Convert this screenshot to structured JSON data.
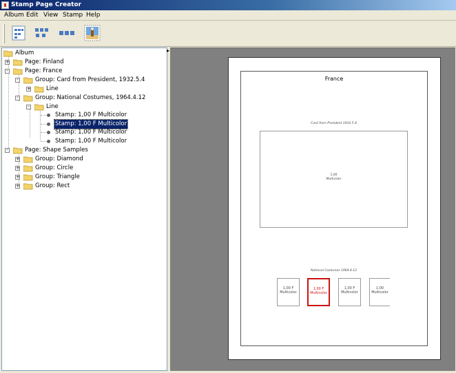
{
  "window": {
    "title": "Stamp Page Creator"
  },
  "menu": [
    {
      "id": "album",
      "label": "Album"
    },
    {
      "id": "edit",
      "label": "Edit"
    },
    {
      "id": "view",
      "label": "View"
    },
    {
      "id": "stamp",
      "label": "Stamp"
    },
    {
      "id": "help",
      "label": "Help"
    }
  ],
  "toolbar": {
    "buttons": [
      {
        "name": "new-page-icon"
      },
      {
        "name": "add-group-icon"
      },
      {
        "name": "add-line-icon"
      },
      {
        "name": "add-stamp-image-icon"
      }
    ]
  },
  "tree": {
    "rows": [
      {
        "label": "Album",
        "icon": "folder"
      },
      {
        "label": "Page: Finland",
        "icon": "folder",
        "expander": "+"
      },
      {
        "label": "Page: France",
        "icon": "folder",
        "expander": "-"
      },
      {
        "label": "Group: Card from President, 1932.5.4",
        "icon": "folder",
        "expander": "-"
      },
      {
        "label": "Line",
        "icon": "folder",
        "expander": "+"
      },
      {
        "label": "Group: National Costumes, 1964.4.12",
        "icon": "folder",
        "expander": "-"
      },
      {
        "label": "Line",
        "icon": "folder",
        "expander": "-"
      },
      {
        "label": "Stamp: 1,00 F Multicolor",
        "icon": "leaf"
      },
      {
        "label": "Stamp: 1,00 F Multicolor",
        "icon": "leaf",
        "selected": true
      },
      {
        "label": "Stamp: 1,00 F Multicolor",
        "icon": "leaf"
      },
      {
        "label": "Stamp: 1,00 F Multicolor",
        "icon": "leaf"
      },
      {
        "label": "Page: Shape Samples",
        "icon": "folder",
        "expander": "-"
      },
      {
        "label": "Group: Diamond",
        "icon": "folder",
        "expander": "+"
      },
      {
        "label": "Group: Circle",
        "icon": "folder",
        "expander": "+"
      },
      {
        "label": "Group: Triangle",
        "icon": "folder",
        "expander": "+"
      },
      {
        "label": "Group: Rect",
        "icon": "folder",
        "expander": "+"
      }
    ]
  },
  "preview": {
    "page_title": "France",
    "group1_label": "Card from President 1932.5.4",
    "big_stamp": {
      "value": "1,00",
      "color": "Multicolor"
    },
    "group2_label": "National Costumes 1964.4.12",
    "stamps": [
      {
        "value": "1,00 F",
        "color": "Multicolor"
      },
      {
        "value": "1,00 F",
        "color": "Multicolor"
      },
      {
        "value": "1,00 F",
        "color": "Multicolor"
      },
      {
        "value": "1,00",
        "color": "Multicolor"
      }
    ],
    "selected_color": "#cc1111"
  }
}
